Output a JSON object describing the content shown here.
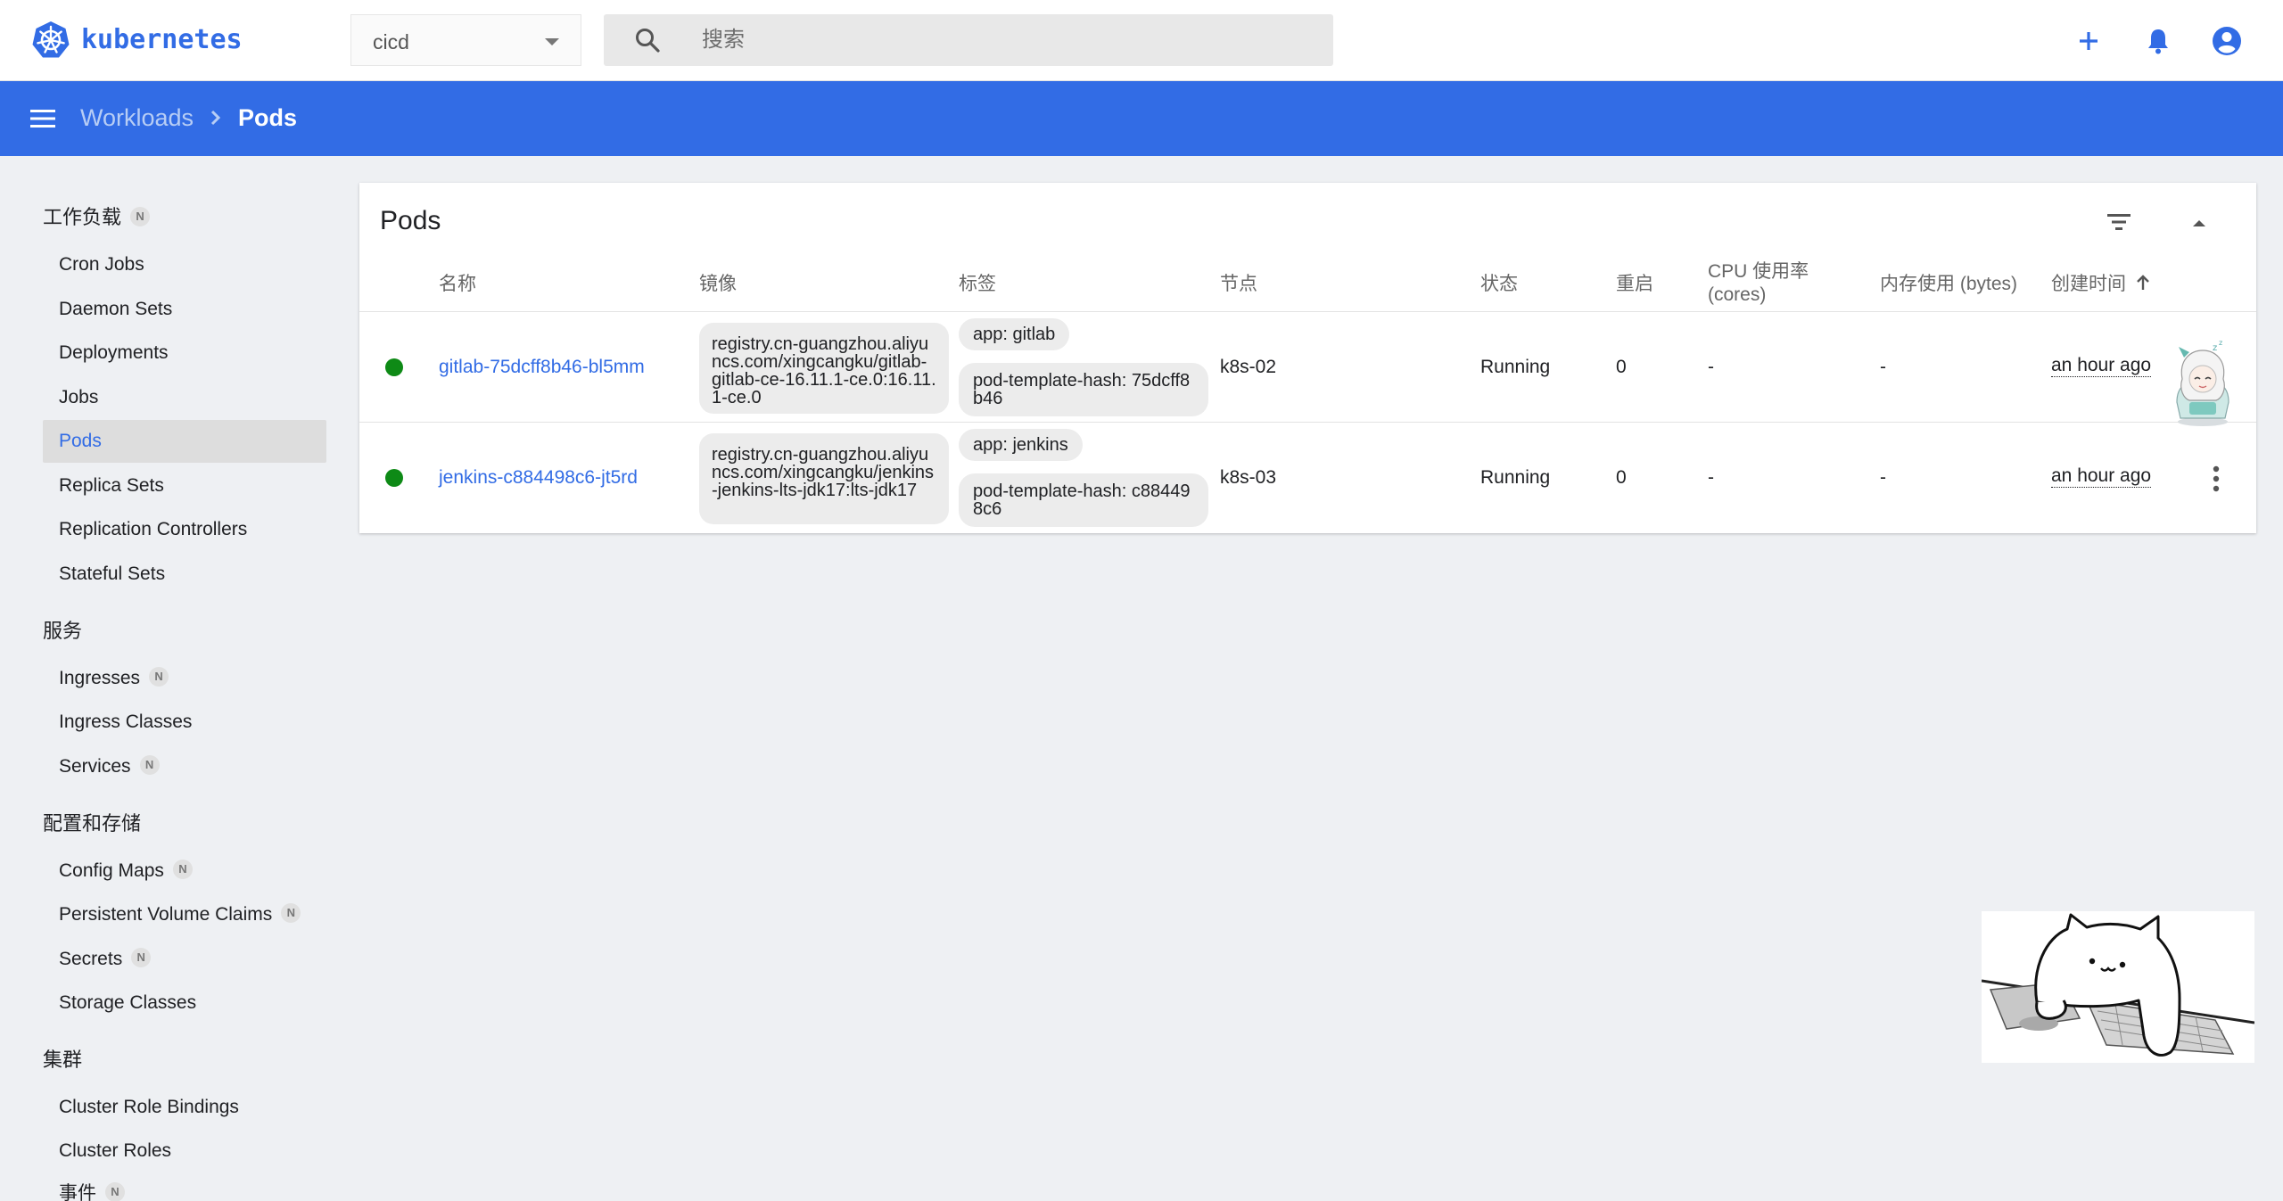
{
  "app": {
    "brand": "kubernetes",
    "namespace": "cicd",
    "search_placeholder": "搜索",
    "accent_color": "#326ce5"
  },
  "toolbar_icons": [
    "plus-icon",
    "bell-icon",
    "account-icon"
  ],
  "breadcrumb": {
    "parent": "Workloads",
    "current": "Pods"
  },
  "sidebar": {
    "sections": [
      {
        "title": "工作负载",
        "badge": "N",
        "items": [
          {
            "label": "Cron Jobs"
          },
          {
            "label": "Daemon Sets"
          },
          {
            "label": "Deployments"
          },
          {
            "label": "Jobs"
          },
          {
            "label": "Pods",
            "active": true
          },
          {
            "label": "Replica Sets"
          },
          {
            "label": "Replication Controllers"
          },
          {
            "label": "Stateful Sets"
          }
        ]
      },
      {
        "title": "服务",
        "items": [
          {
            "label": "Ingresses",
            "badge": "N"
          },
          {
            "label": "Ingress Classes"
          },
          {
            "label": "Services",
            "badge": "N"
          }
        ]
      },
      {
        "title": "配置和存储",
        "items": [
          {
            "label": "Config Maps",
            "badge": "N"
          },
          {
            "label": "Persistent Volume Claims",
            "badge": "N"
          },
          {
            "label": "Secrets",
            "badge": "N"
          },
          {
            "label": "Storage Classes"
          }
        ]
      },
      {
        "title": "集群",
        "items": [
          {
            "label": "Cluster Role Bindings"
          },
          {
            "label": "Cluster Roles"
          },
          {
            "label": "事件",
            "badge": "N"
          }
        ]
      }
    ]
  },
  "pods_card": {
    "title": "Pods",
    "columns": {
      "name": "名称",
      "image": "镜像",
      "labels": "标签",
      "node": "节点",
      "status": "状态",
      "restarts": "重启",
      "cpu_line1": "CPU 使用率",
      "cpu_line2": "(cores)",
      "memory": "内存使用 (bytes)",
      "created": "创建时间"
    },
    "rows": [
      {
        "name": "gitlab-75dcff8b46-bl5mm",
        "image": "registry.cn-guangzhou.aliyuncs.com/xingcangku/gitlab-gitlab-ce-16.11.1-ce.0:16.11.1-ce.0",
        "label_app": "app: gitlab",
        "label_hash": "pod-template-hash: 75dcff8b46",
        "node": "k8s-02",
        "status": "Running",
        "restarts": "0",
        "cpu": "-",
        "memory": "-",
        "created": "an hour ago",
        "status_color": "#0e8a16"
      },
      {
        "name": "jenkins-c884498c6-jt5rd",
        "image": "registry.cn-guangzhou.aliyuncs.com/xingcangku/jenkins-jenkins-lts-jdk17:lts-jdk17",
        "label_app": "app: jenkins",
        "label_hash": "pod-template-hash: c884498c6",
        "node": "k8s-03",
        "status": "Running",
        "restarts": "0",
        "cpu": "-",
        "memory": "-",
        "created": "an hour ago",
        "status_color": "#0e8a16"
      }
    ]
  }
}
